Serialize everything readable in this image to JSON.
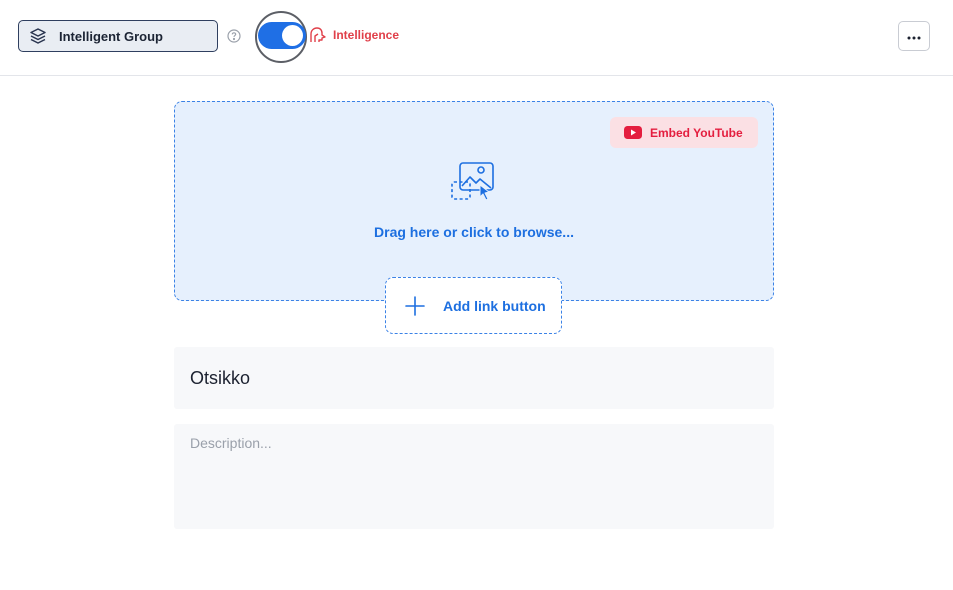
{
  "header": {
    "group_select_label": "Intelligent Group",
    "group_select_icon": "layers-icon",
    "help_icon": "question-circle-icon",
    "intelligence_toggle_on": true,
    "intelligence_icon": "intelligence-icon",
    "intelligence_label": "Intelligence",
    "more_icon": "more-horizontal-icon"
  },
  "media": {
    "embed_youtube_label": "Embed YouTube",
    "embed_youtube_icon": "youtube-icon",
    "upload_icon": "image-upload-icon",
    "drop_text": "Drag here or click to browse...",
    "add_link_label": "Add link button",
    "add_link_icon": "plus-icon"
  },
  "form": {
    "title_value": "Otsikko",
    "description_placeholder": "Description...",
    "description_value": ""
  },
  "colors": {
    "accent": "#1f6fe5",
    "intelligence_red": "#e0404a",
    "youtube_red": "#e41e3f",
    "dropzone_bg": "#e6f0fd"
  }
}
